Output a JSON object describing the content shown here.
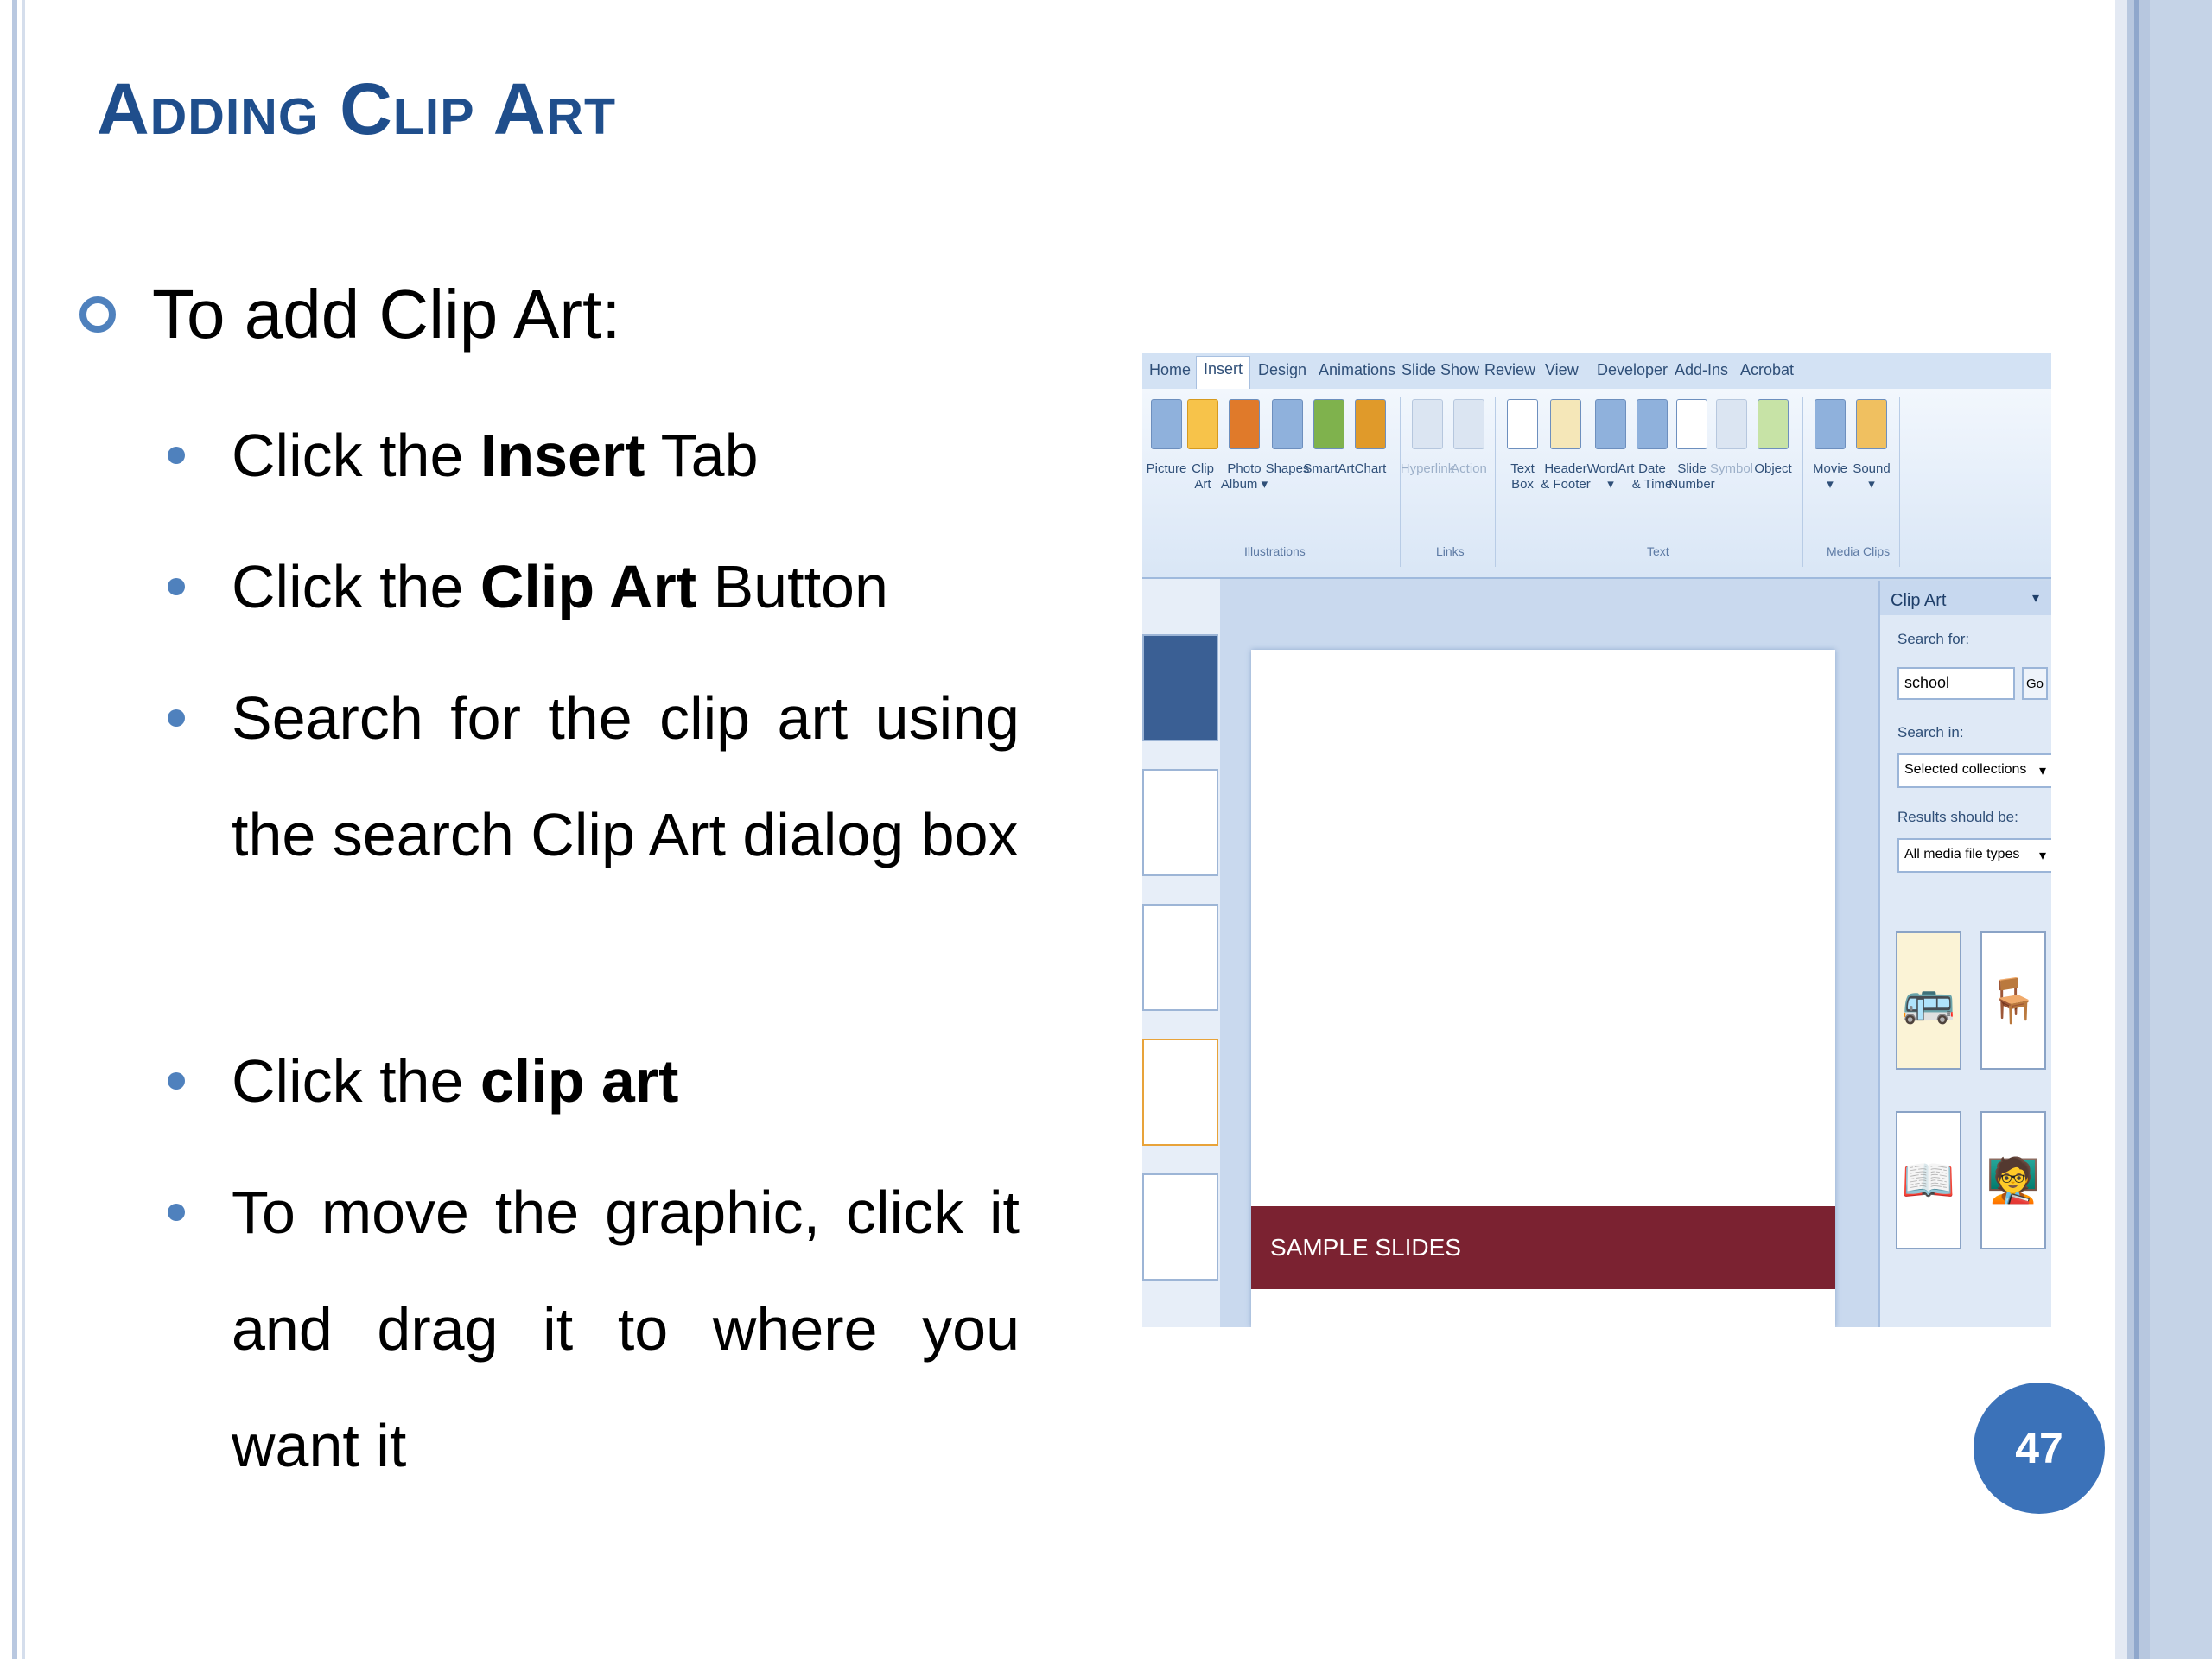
{
  "slide": {
    "title": "Adding Clip Art",
    "main_bullet": "To add Clip Art:",
    "steps": [
      {
        "pre": "Click the ",
        "bold": "Insert",
        "post": " Tab"
      },
      {
        "pre": "Click the ",
        "bold": "Clip Art",
        "post": " Button"
      },
      {
        "pre": "Search for the clip art using the search Clip Art dialog box",
        "bold": "",
        "post": ""
      },
      {
        "pre": "Click the ",
        "bold": "clip art",
        "post": ""
      },
      {
        "pre": "To move the graphic, click it and drag it to where you want it",
        "bold": "",
        "post": ""
      }
    ],
    "page_number": "47"
  },
  "screenshot": {
    "tabs": [
      "Home",
      "Insert",
      "Design",
      "Animations",
      "Slide Show",
      "Review",
      "View",
      "Developer",
      "Add-Ins",
      "Acrobat"
    ],
    "active_tab": "Insert",
    "ribbon_buttons": [
      {
        "label": "Picture"
      },
      {
        "label": "Clip\nArt"
      },
      {
        "label": "Photo\nAlbum ▾"
      },
      {
        "label": "Shapes"
      },
      {
        "label": "SmartArt"
      },
      {
        "label": "Chart"
      },
      {
        "label": "Hyperlink"
      },
      {
        "label": "Action"
      },
      {
        "label": "Text\nBox"
      },
      {
        "label": "Header\n& Footer"
      },
      {
        "label": "WordArt\n▾"
      },
      {
        "label": "Date\n& Time"
      },
      {
        "label": "Slide\nNumber"
      },
      {
        "label": "Symbol"
      },
      {
        "label": "Object"
      },
      {
        "label": "Movie\n▾"
      },
      {
        "label": "Sound\n▾"
      }
    ],
    "groups": [
      "Illustrations",
      "Links",
      "Text",
      "Media Clips"
    ],
    "slide_footer": "SAMPLE SLIDES",
    "clip_art_pane": {
      "title": "Clip Art",
      "search_for_label": "Search for:",
      "search_value": "school",
      "go_label": "Go",
      "search_in_label": "Search in:",
      "search_in_value": "Selected collections",
      "results_label": "Results should be:",
      "results_value": "All media file types",
      "results": [
        "school-bus-icon",
        "desk-icon",
        "reading-icon",
        "teacher-icon"
      ]
    }
  },
  "colors": {
    "title": "#1f4e8c",
    "bullet": "#4f81bd",
    "page_badge": "#3b72b9",
    "slide_bar": "#7b2231"
  }
}
